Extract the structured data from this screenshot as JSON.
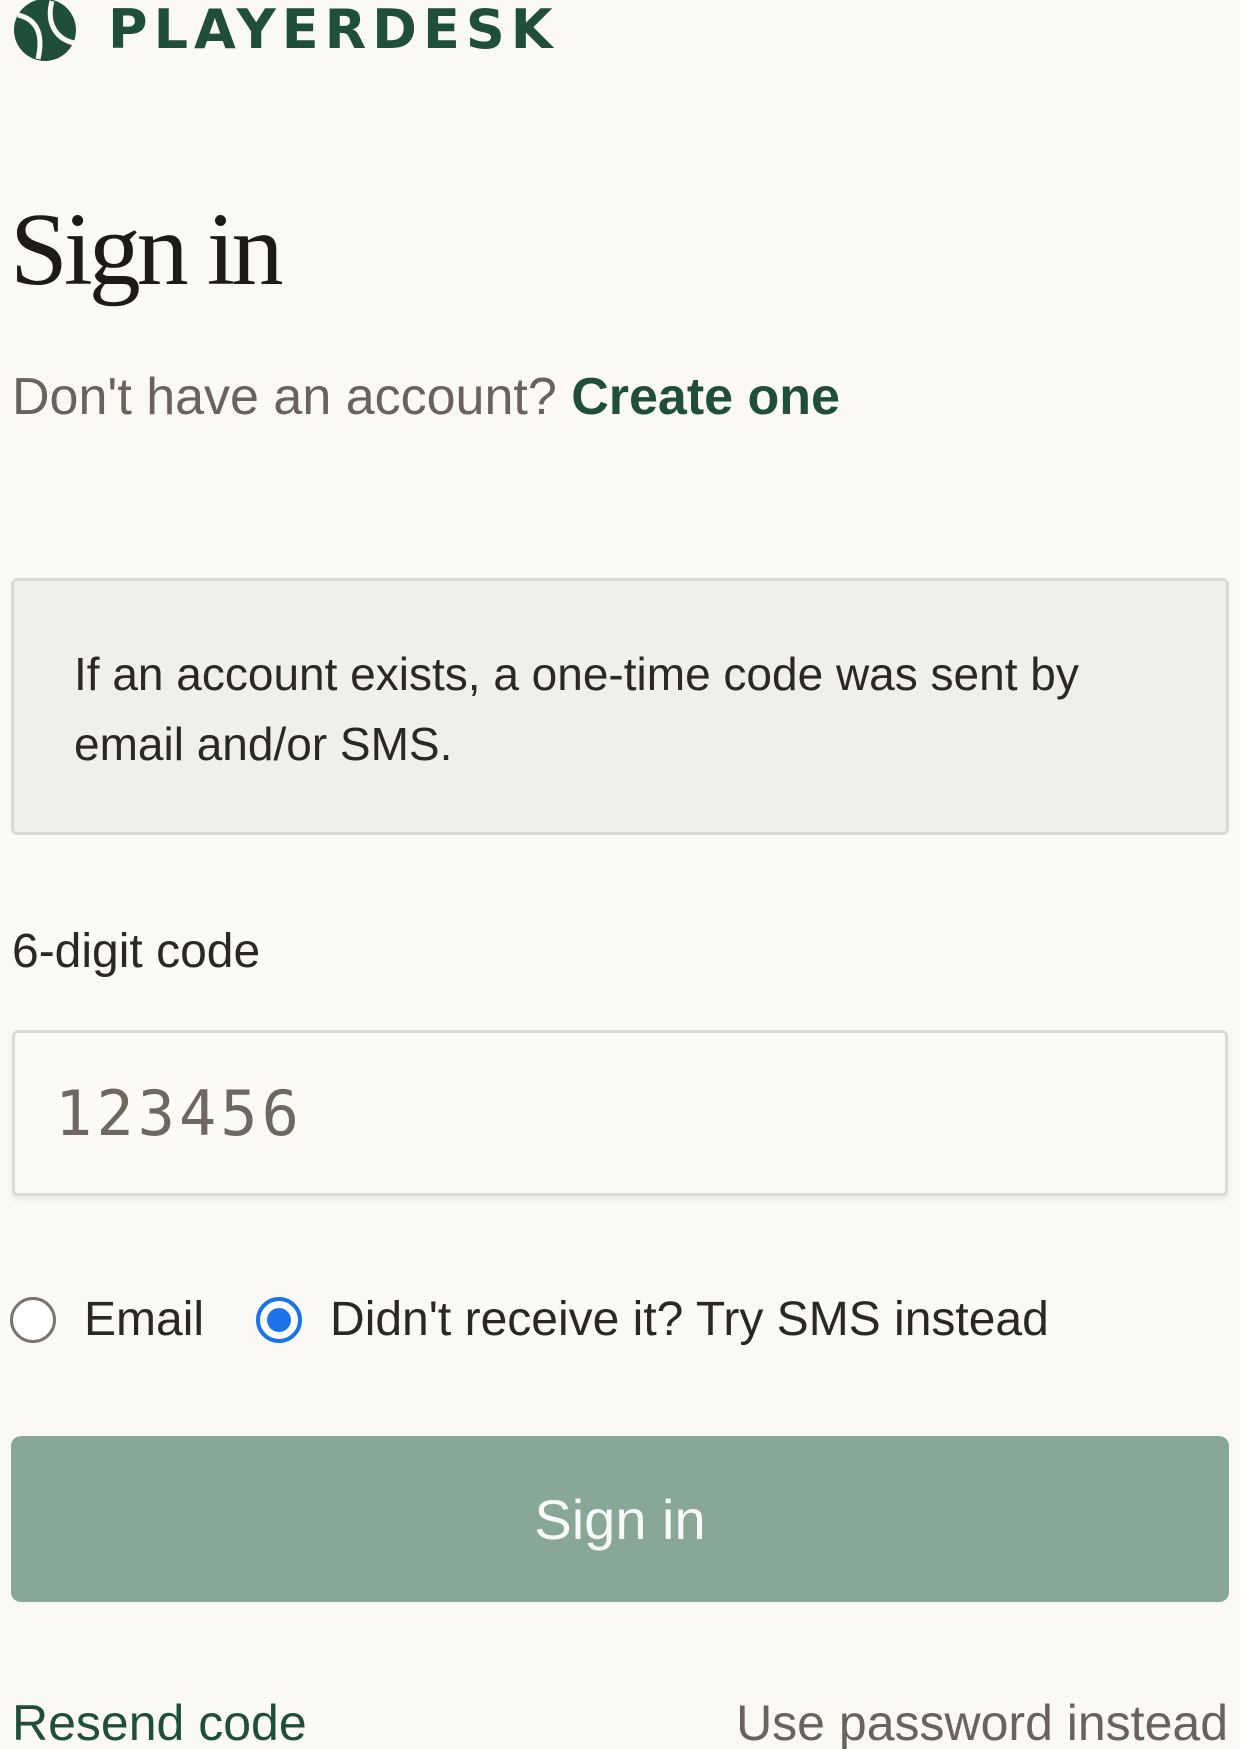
{
  "brand": {
    "name": "PLAYERDESK",
    "logo_icon": "tennis-ball-icon",
    "color": "#1f4f3a"
  },
  "page": {
    "title": "Sign in",
    "account_prompt": "Don't have an account?",
    "create_link": "Create one"
  },
  "notice": {
    "text": "If an account exists, a one-time code was sent by email and/or SMS."
  },
  "code_field": {
    "label": "6-digit code",
    "placeholder": "123456",
    "value": ""
  },
  "delivery_options": [
    {
      "label": "Email",
      "checked": false
    },
    {
      "label": "Didn't receive it? Try SMS instead",
      "checked": true
    }
  ],
  "submit": {
    "label": "Sign in",
    "color": "#88a797"
  },
  "footer": {
    "resend_label": "Resend code",
    "password_label": "Use password instead"
  },
  "colors": {
    "accent": "#1f4f3a",
    "radio_selected": "#1a73e8",
    "background": "#faf9f6"
  }
}
